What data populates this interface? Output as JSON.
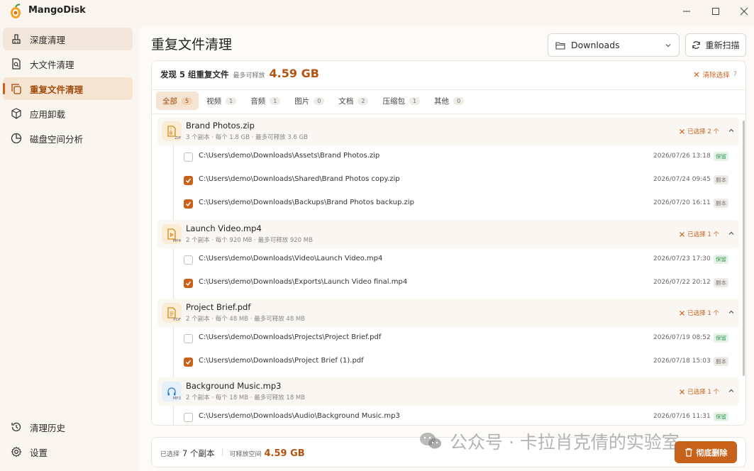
{
  "app": {
    "title": "MangoDisk"
  },
  "sidebar": {
    "items": [
      {
        "label": "深度清理",
        "icon": "broom-icon"
      },
      {
        "label": "大文件清理",
        "icon": "search-file-icon"
      },
      {
        "label": "重复文件清理",
        "icon": "copy-icon"
      },
      {
        "label": "应用卸载",
        "icon": "package-icon"
      },
      {
        "label": "磁盘空间分析",
        "icon": "pie-chart-icon"
      }
    ],
    "bottom": [
      {
        "label": "清理历史",
        "icon": "history-icon"
      },
      {
        "label": "设置",
        "icon": "gear-icon"
      }
    ]
  },
  "header": {
    "title": "重复文件清理",
    "folder": "Downloads",
    "rescan": "重新扫描"
  },
  "summary": {
    "found": "发现 5 组重复文件",
    "max_label": "最多可释放",
    "max_size": "4.59 GB",
    "clear_label": "清除选择",
    "clear_count": "7"
  },
  "tabs": [
    {
      "label": "全部",
      "count": "5"
    },
    {
      "label": "视频",
      "count": "1"
    },
    {
      "label": "音频",
      "count": "1"
    },
    {
      "label": "图片",
      "count": "0"
    },
    {
      "label": "文档",
      "count": "2"
    },
    {
      "label": "压缩包",
      "count": "1"
    },
    {
      "label": "其他",
      "count": "0"
    }
  ],
  "groups": [
    {
      "name": "Brand Photos.zip",
      "ext": "ZIP",
      "meta": "3 个副本 · 每个 1.8 GB · 最多可释放 3.6 GB",
      "selected": "已选择 2 个",
      "files": [
        {
          "path": "C:\\Users\\demo\\Downloads\\Assets\\Brand Photos.zip",
          "date": "2026/07/26 13:18",
          "tag": "保留",
          "checked": false
        },
        {
          "path": "C:\\Users\\demo\\Downloads\\Shared\\Brand Photos copy.zip",
          "date": "2026/07/24 09:45",
          "tag": "副本",
          "checked": true
        },
        {
          "path": "C:\\Users\\demo\\Downloads\\Backups\\Brand Photos backup.zip",
          "date": "2026/07/20 16:11",
          "tag": "副本",
          "checked": true
        }
      ]
    },
    {
      "name": "Launch Video.mp4",
      "ext": "MP4",
      "meta": "2 个副本 · 每个 920 MB · 最多可释放 920 MB",
      "selected": "已选择 1 个",
      "files": [
        {
          "path": "C:\\Users\\demo\\Downloads\\Video\\Launch Video.mp4",
          "date": "2026/07/23 17:30",
          "tag": "保留",
          "checked": false
        },
        {
          "path": "C:\\Users\\demo\\Downloads\\Exports\\Launch Video final.mp4",
          "date": "2026/07/22 20:12",
          "tag": "副本",
          "checked": true
        }
      ]
    },
    {
      "name": "Project Brief.pdf",
      "ext": "PDF",
      "meta": "2 个副本 · 每个 48 MB · 最多可释放 48 MB",
      "selected": "已选择 1 个",
      "files": [
        {
          "path": "C:\\Users\\demo\\Downloads\\Projects\\Project Brief.pdf",
          "date": "2026/07/19 08:52",
          "tag": "保留",
          "checked": false
        },
        {
          "path": "C:\\Users\\demo\\Downloads\\Project Brief (1).pdf",
          "date": "2026/07/18 15:03",
          "tag": "副本",
          "checked": true
        }
      ]
    },
    {
      "name": "Background Music.mp3",
      "ext": "MP3",
      "meta": "2 个副本 · 每个 18 MB · 最多可释放 18 MB",
      "selected": "已选择 1 个",
      "files": [
        {
          "path": "C:\\Users\\demo\\Downloads\\Audio\\Background Music.mp3",
          "date": "2026/07/16 11:31",
          "tag": "保留",
          "checked": false
        }
      ]
    }
  ],
  "footer": {
    "selected_label": "已选择",
    "selected_value": "7 个副本",
    "space_label": "可释放空间",
    "space_value": "4.59 GB",
    "delete_label": "彻底删除"
  },
  "watermark": "公众号 · 卡拉肖克倩的实验室",
  "colors": {
    "accent": "#c8611a",
    "accent_text": "#b5530e",
    "keep": "#3a9b52"
  }
}
